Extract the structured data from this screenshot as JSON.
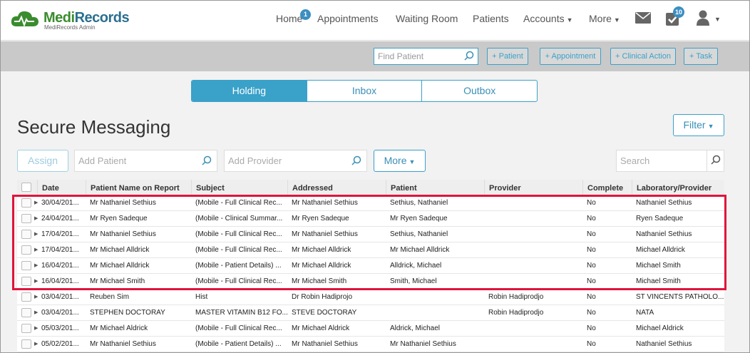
{
  "app": {
    "logo_name": "MediRecords",
    "logo_sub": "MediRecords Admin"
  },
  "nav": {
    "home": "Home",
    "home_badge": "1",
    "appointments": "Appointments",
    "waiting_room": "Waiting Room",
    "patients": "Patients",
    "accounts": "Accounts",
    "more": "More",
    "tasks_badge": "10"
  },
  "actionbar": {
    "find_placeholder": "Find Patient",
    "add_patient": "+ Patient",
    "add_appointment": "+ Appointment",
    "add_clinical_action": "+ Clinical Action",
    "add_task": "+ Task"
  },
  "tabs": [
    "Holding",
    "Inbox",
    "Outbox"
  ],
  "page": {
    "title": "Secure Messaging",
    "filter": "Filter",
    "assign": "Assign",
    "add_patient_placeholder": "Add Patient",
    "add_provider_placeholder": "Add Provider",
    "more": "More",
    "search_placeholder": "Search"
  },
  "table": {
    "headers": [
      "Date",
      "Patient Name on Report",
      "Subject",
      "Addressed",
      "Patient",
      "Provider",
      "Complete",
      "Laboratory/Provider"
    ],
    "rows": [
      [
        "30/04/201...",
        "Mr Nathaniel Sethius",
        "(Mobile - Full Clinical Rec...",
        "Mr Nathaniel Sethius",
        "Sethius, Nathaniel",
        "",
        "No",
        "Nathaniel Sethius"
      ],
      [
        "24/04/201...",
        "Mr Ryen Sadeque",
        "(Mobile - Clinical Summar...",
        "Mr Ryen Sadeque",
        "Mr Ryen Sadeque",
        "",
        "No",
        "Ryen Sadeque"
      ],
      [
        "17/04/201...",
        "Mr Nathaniel Sethius",
        "(Mobile - Full Clinical Rec...",
        "Mr Nathaniel Sethius",
        "Sethius, Nathaniel",
        "",
        "No",
        "Nathaniel Sethius"
      ],
      [
        "17/04/201...",
        "Mr Michael Alldrick",
        "(Mobile - Full Clinical Rec...",
        "Mr Michael Alldrick",
        "Mr Michael Alldrick",
        "",
        "No",
        "Michael Alldrick"
      ],
      [
        "16/04/201...",
        "Mr Michael Alldrick",
        "(Mobile - Patient Details) ...",
        "Mr Michael Alldrick",
        "Alldrick, Michael",
        "",
        "No",
        "Michael Smith"
      ],
      [
        "16/04/201...",
        "Mr Michael Smith",
        "(Mobile - Full Clinical Rec...",
        "Mr Michael Smith",
        "Smith, Michael",
        "",
        "No",
        "Michael Smith"
      ],
      [
        "03/04/201...",
        "Reuben Sim",
        "Hist",
        "Dr Robin Hadiprojo",
        "",
        "Robin Hadiprodjo",
        "No",
        "ST VINCENTS PATHOLO..."
      ],
      [
        "03/04/201...",
        "STEPHEN DOCTORAY",
        "MASTER VITAMIN B12 FO...",
        "STEVE DOCTORAY",
        "",
        "Robin Hadiprodjo",
        "No",
        "NATA"
      ],
      [
        "05/03/201...",
        "Mr Michael Aldrick",
        "(Mobile - Full Clinical Rec...",
        "Mr Michael Aldrick",
        "Aldrick, Michael",
        "",
        "No",
        "Michael Aldrick"
      ],
      [
        "05/02/201...",
        "Mr Nathaniel Sethius",
        "(Mobile - Patient Details) ...",
        "Mr Nathaniel Sethius",
        "Mr Nathaniel Sethius",
        "",
        "No",
        "Nathaniel Sethius"
      ]
    ]
  },
  "colors": {
    "accent": "#3aa1c9",
    "highlight": "#e0143c",
    "logo_green": "#3a8c2e"
  }
}
